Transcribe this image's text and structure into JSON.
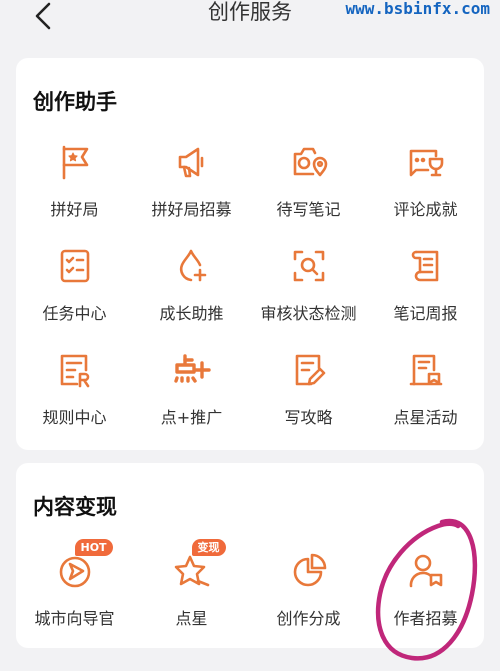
{
  "header": {
    "title": "创作服务",
    "watermark": "www.bsbinfx.com"
  },
  "colors": {
    "accent": "#e8783a",
    "badge": "#f06a3b",
    "annotation": "#c0277a"
  },
  "sections": [
    {
      "title": "创作助手",
      "items": [
        {
          "label": "拼好局",
          "icon": "flag-icon"
        },
        {
          "label": "拼好局招募",
          "icon": "megaphone-icon"
        },
        {
          "label": "待写笔记",
          "icon": "camera-location-icon"
        },
        {
          "label": "评论成就",
          "icon": "comment-trophy-icon"
        },
        {
          "label": "任务中心",
          "icon": "checklist-icon"
        },
        {
          "label": "成长助推",
          "icon": "growth-drop-icon"
        },
        {
          "label": "审核状态检测",
          "icon": "scan-search-icon"
        },
        {
          "label": "笔记周报",
          "icon": "scroll-icon"
        },
        {
          "label": "规则中心",
          "icon": "rules-doc-icon"
        },
        {
          "label": "点+推广",
          "icon": "dian-plus-icon"
        },
        {
          "label": "写攻略",
          "icon": "write-guide-icon"
        },
        {
          "label": "点星活动",
          "icon": "event-doc-icon"
        }
      ]
    },
    {
      "title": "内容变现",
      "items": [
        {
          "label": "城市向导官",
          "icon": "city-guide-icon",
          "badge": "HOT"
        },
        {
          "label": "点星",
          "icon": "star-icon",
          "badge": "变现"
        },
        {
          "label": "创作分成",
          "icon": "pie-chart-icon"
        },
        {
          "label": "作者招募",
          "icon": "author-recruit-icon"
        }
      ]
    }
  ]
}
